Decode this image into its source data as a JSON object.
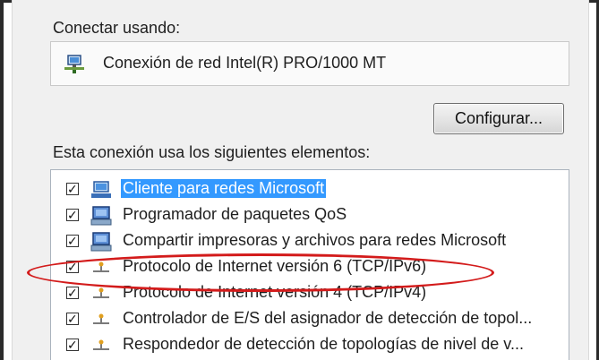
{
  "connect_using": {
    "label": "Conectar usando:",
    "adapter": "Conexión de red Intel(R) PRO/1000 MT",
    "adapter_icon": "network-adapter-icon"
  },
  "configure_button": "Configurar...",
  "elements_label": "Esta conexión usa los siguientes elementos:",
  "items": [
    {
      "label": "Cliente para redes Microsoft",
      "checked": true,
      "icon": "network-client-icon",
      "selected": true
    },
    {
      "label": "Programador de paquetes QoS",
      "checked": true,
      "icon": "service-icon",
      "selected": false
    },
    {
      "label": "Compartir impresoras y archivos para redes Microsoft",
      "checked": true,
      "icon": "service-icon",
      "selected": false
    },
    {
      "label": "Protocolo de Internet versión 6 (TCP/IPv6)",
      "checked": true,
      "icon": "protocol-icon",
      "selected": false
    },
    {
      "label": "Protocolo de Internet versión 4 (TCP/IPv4)",
      "checked": true,
      "icon": "protocol-icon",
      "selected": false
    },
    {
      "label": "Controlador de E/S del asignador de detección de topol...",
      "checked": true,
      "icon": "protocol-icon",
      "selected": false
    },
    {
      "label": "Respondedor de detección de topologías de nivel de v...",
      "checked": true,
      "icon": "protocol-icon",
      "selected": false
    }
  ],
  "colors": {
    "selection": "#3399ff",
    "highlight_ellipse": "#d31b1b"
  }
}
